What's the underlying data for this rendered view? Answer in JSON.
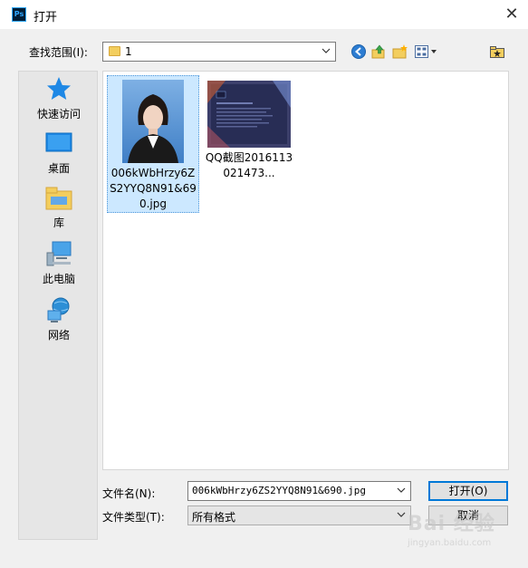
{
  "window": {
    "title": "打开",
    "app_icon": "Ps",
    "close_glyph": "✕"
  },
  "lookin": {
    "label": "查找范围(I):",
    "value": "1"
  },
  "places": [
    {
      "label": "快速访问",
      "icon": "star-icon"
    },
    {
      "label": "桌面",
      "icon": "desktop-icon"
    },
    {
      "label": "库",
      "icon": "library-icon"
    },
    {
      "label": "此电脑",
      "icon": "computer-icon"
    },
    {
      "label": "网络",
      "icon": "network-icon"
    }
  ],
  "files": [
    {
      "name": "006kWbHrzy6ZS2YYQ8N91&690.jpg",
      "selected": true
    },
    {
      "name": "QQ截图2016113021473...",
      "selected": false
    }
  ],
  "filename": {
    "label": "文件名(N):",
    "value": "006kWbHrzy6ZS2YYQ8N91&690.jpg"
  },
  "filetype": {
    "label": "文件类型(T):",
    "value": "所有格式"
  },
  "buttons": {
    "open": "打开(O)",
    "cancel": "取消"
  },
  "watermark": {
    "main": "Bai 经验",
    "sub": "jingyan.baidu.com"
  },
  "colors": {
    "selection": "#cce8ff",
    "accent": "#0078d7",
    "folder": "#f3ce5e"
  }
}
